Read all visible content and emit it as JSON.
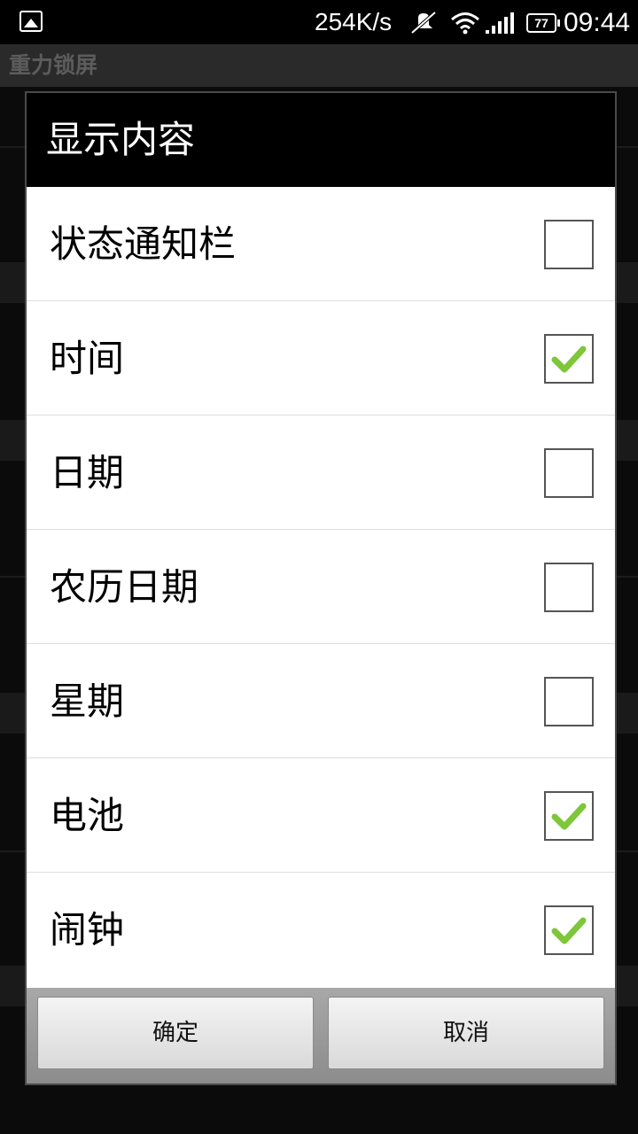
{
  "status_bar": {
    "network_speed": "254K/s",
    "battery_level": "77",
    "time": "09:44",
    "icons": [
      "gallery-icon",
      "mute-icon",
      "wifi-icon",
      "signal-icon",
      "battery-icon"
    ]
  },
  "background": {
    "title": "重力锁屏"
  },
  "dialog": {
    "title": "显示内容",
    "items": [
      {
        "label": "状态通知栏",
        "checked": false
      },
      {
        "label": "时间",
        "checked": true
      },
      {
        "label": "日期",
        "checked": false
      },
      {
        "label": "农历日期",
        "checked": false
      },
      {
        "label": "星期",
        "checked": false
      },
      {
        "label": "电池",
        "checked": true
      },
      {
        "label": "闹钟",
        "checked": true
      }
    ],
    "ok_label": "确定",
    "cancel_label": "取消"
  },
  "colors": {
    "check_green": "#7ec63a",
    "dialog_bg": "#ffffff",
    "title_bg": "#000000"
  }
}
